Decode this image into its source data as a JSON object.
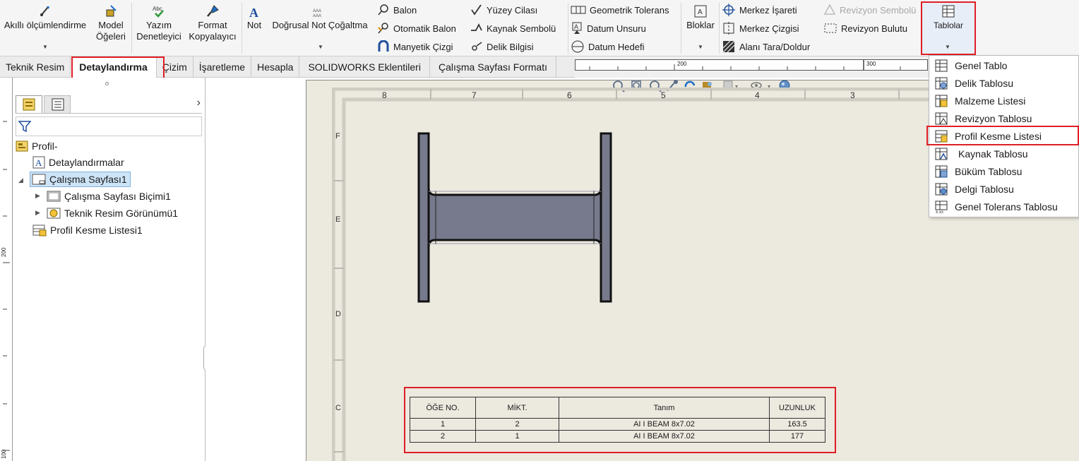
{
  "ribbon": {
    "smart_dimension": "Akıllı ölçümlendirme",
    "model_items": [
      "Model",
      "Öğeleri"
    ],
    "spell_checker": [
      "Yazım",
      "Denetleyici"
    ],
    "format_painter": [
      "Format",
      "Kopyalayıcı"
    ],
    "note": "Not",
    "linear_note": "Doğrusal Not Çoğaltma",
    "balloon": "Balon",
    "auto_balloon": "Otomatik Balon",
    "magnetic_line": "Manyetik Çizgi",
    "surface_finish": "Yüzey Cilası",
    "weld_symbol": "Kaynak Sembolü",
    "hole_callout": "Delik Bilgisi",
    "geometric_tolerance": "Geometrik Tolerans",
    "datum_feature": "Datum Unsuru",
    "datum_target": "Datum Hedefi",
    "blocks": "Bloklar",
    "center_mark": "Merkez İşareti",
    "centerline": "Merkez Çizgisi",
    "area_hatch": "Alanı Tara/Doldur",
    "revision_symbol": "Revizyon Sembolü",
    "revision_cloud": "Revizyon Bulutu",
    "tables": "Tablolar"
  },
  "tabs": [
    "Teknik Resim",
    "Detaylandırma",
    "Çizim",
    "İşaretleme",
    "Hesapla",
    "SOLIDWORKS Eklentileri",
    "Çalışma Sayfası Formatı"
  ],
  "ruler": {
    "top_labels": [
      "200",
      "300"
    ],
    "left_labels": [
      "200",
      "100"
    ]
  },
  "tree": {
    "root": "Profil-",
    "annotations": "Detaylandırmalar",
    "sheet": "Çalışma Sayfası1",
    "sheet_format": "Çalışma Sayfası Biçimi1",
    "drawing_view": "Teknik Resim Görünümü1",
    "cut_list": "Profil Kesme Listesi1"
  },
  "sheet": {
    "zone_numbers": [
      "8",
      "7",
      "6",
      "5",
      "4",
      "3"
    ],
    "zone_letters": [
      "F",
      "E",
      "D",
      "C"
    ]
  },
  "bom": {
    "headers": [
      "ÖĞE NO.",
      "MİKT.",
      "Tanım",
      "UZUNLUK"
    ],
    "rows": [
      [
        "1",
        "2",
        "AI I BEAM 8x7.02",
        "163.5"
      ],
      [
        "2",
        "1",
        "AI I BEAM 8x7.02",
        "177"
      ]
    ]
  },
  "menu": {
    "items": [
      "Genel Tablo",
      "Delik Tablosu",
      "Malzeme Listesi",
      "Revizyon Tablosu",
      "Profil Kesme Listesi",
      "Kaynak Tablosu",
      "Büküm Tablosu",
      "Delgi Tablosu",
      "Genel Tolerans Tablosu"
    ],
    "highlighted": "Profil Kesme Listesi"
  },
  "colors": {
    "highlight": "#e01e26",
    "sheet_bg": "#ece9df",
    "beam": "#777a8c"
  }
}
